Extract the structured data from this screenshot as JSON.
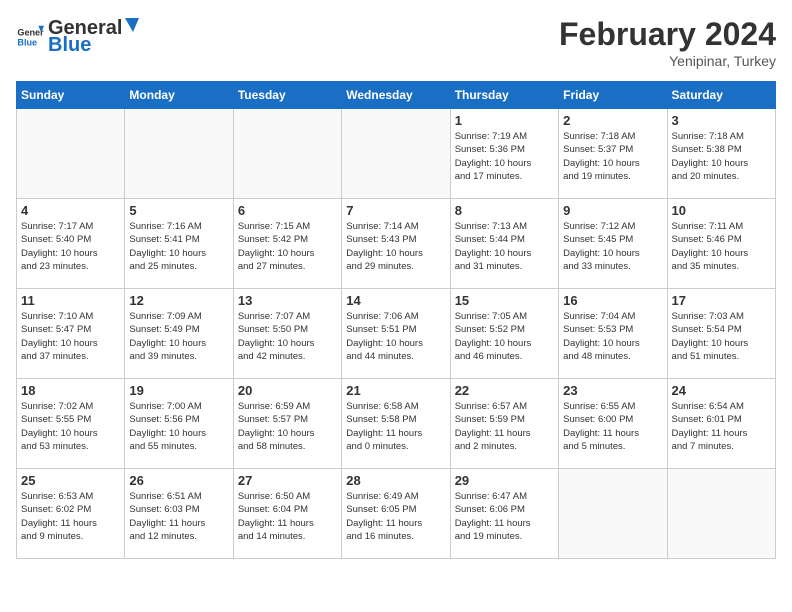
{
  "header": {
    "logo_general": "General",
    "logo_blue": "Blue",
    "title": "February 2024",
    "subtitle": "Yenipinar, Turkey"
  },
  "columns": [
    "Sunday",
    "Monday",
    "Tuesday",
    "Wednesday",
    "Thursday",
    "Friday",
    "Saturday"
  ],
  "weeks": [
    {
      "days": [
        {
          "num": "",
          "info": ""
        },
        {
          "num": "",
          "info": ""
        },
        {
          "num": "",
          "info": ""
        },
        {
          "num": "",
          "info": ""
        },
        {
          "num": "1",
          "info": "Sunrise: 7:19 AM\nSunset: 5:36 PM\nDaylight: 10 hours\nand 17 minutes."
        },
        {
          "num": "2",
          "info": "Sunrise: 7:18 AM\nSunset: 5:37 PM\nDaylight: 10 hours\nand 19 minutes."
        },
        {
          "num": "3",
          "info": "Sunrise: 7:18 AM\nSunset: 5:38 PM\nDaylight: 10 hours\nand 20 minutes."
        }
      ]
    },
    {
      "days": [
        {
          "num": "4",
          "info": "Sunrise: 7:17 AM\nSunset: 5:40 PM\nDaylight: 10 hours\nand 23 minutes."
        },
        {
          "num": "5",
          "info": "Sunrise: 7:16 AM\nSunset: 5:41 PM\nDaylight: 10 hours\nand 25 minutes."
        },
        {
          "num": "6",
          "info": "Sunrise: 7:15 AM\nSunset: 5:42 PM\nDaylight: 10 hours\nand 27 minutes."
        },
        {
          "num": "7",
          "info": "Sunrise: 7:14 AM\nSunset: 5:43 PM\nDaylight: 10 hours\nand 29 minutes."
        },
        {
          "num": "8",
          "info": "Sunrise: 7:13 AM\nSunset: 5:44 PM\nDaylight: 10 hours\nand 31 minutes."
        },
        {
          "num": "9",
          "info": "Sunrise: 7:12 AM\nSunset: 5:45 PM\nDaylight: 10 hours\nand 33 minutes."
        },
        {
          "num": "10",
          "info": "Sunrise: 7:11 AM\nSunset: 5:46 PM\nDaylight: 10 hours\nand 35 minutes."
        }
      ]
    },
    {
      "days": [
        {
          "num": "11",
          "info": "Sunrise: 7:10 AM\nSunset: 5:47 PM\nDaylight: 10 hours\nand 37 minutes."
        },
        {
          "num": "12",
          "info": "Sunrise: 7:09 AM\nSunset: 5:49 PM\nDaylight: 10 hours\nand 39 minutes."
        },
        {
          "num": "13",
          "info": "Sunrise: 7:07 AM\nSunset: 5:50 PM\nDaylight: 10 hours\nand 42 minutes."
        },
        {
          "num": "14",
          "info": "Sunrise: 7:06 AM\nSunset: 5:51 PM\nDaylight: 10 hours\nand 44 minutes."
        },
        {
          "num": "15",
          "info": "Sunrise: 7:05 AM\nSunset: 5:52 PM\nDaylight: 10 hours\nand 46 minutes."
        },
        {
          "num": "16",
          "info": "Sunrise: 7:04 AM\nSunset: 5:53 PM\nDaylight: 10 hours\nand 48 minutes."
        },
        {
          "num": "17",
          "info": "Sunrise: 7:03 AM\nSunset: 5:54 PM\nDaylight: 10 hours\nand 51 minutes."
        }
      ]
    },
    {
      "days": [
        {
          "num": "18",
          "info": "Sunrise: 7:02 AM\nSunset: 5:55 PM\nDaylight: 10 hours\nand 53 minutes."
        },
        {
          "num": "19",
          "info": "Sunrise: 7:00 AM\nSunset: 5:56 PM\nDaylight: 10 hours\nand 55 minutes."
        },
        {
          "num": "20",
          "info": "Sunrise: 6:59 AM\nSunset: 5:57 PM\nDaylight: 10 hours\nand 58 minutes."
        },
        {
          "num": "21",
          "info": "Sunrise: 6:58 AM\nSunset: 5:58 PM\nDaylight: 11 hours\nand 0 minutes."
        },
        {
          "num": "22",
          "info": "Sunrise: 6:57 AM\nSunset: 5:59 PM\nDaylight: 11 hours\nand 2 minutes."
        },
        {
          "num": "23",
          "info": "Sunrise: 6:55 AM\nSunset: 6:00 PM\nDaylight: 11 hours\nand 5 minutes."
        },
        {
          "num": "24",
          "info": "Sunrise: 6:54 AM\nSunset: 6:01 PM\nDaylight: 11 hours\nand 7 minutes."
        }
      ]
    },
    {
      "days": [
        {
          "num": "25",
          "info": "Sunrise: 6:53 AM\nSunset: 6:02 PM\nDaylight: 11 hours\nand 9 minutes."
        },
        {
          "num": "26",
          "info": "Sunrise: 6:51 AM\nSunset: 6:03 PM\nDaylight: 11 hours\nand 12 minutes."
        },
        {
          "num": "27",
          "info": "Sunrise: 6:50 AM\nSunset: 6:04 PM\nDaylight: 11 hours\nand 14 minutes."
        },
        {
          "num": "28",
          "info": "Sunrise: 6:49 AM\nSunset: 6:05 PM\nDaylight: 11 hours\nand 16 minutes."
        },
        {
          "num": "29",
          "info": "Sunrise: 6:47 AM\nSunset: 6:06 PM\nDaylight: 11 hours\nand 19 minutes."
        },
        {
          "num": "",
          "info": ""
        },
        {
          "num": "",
          "info": ""
        }
      ]
    }
  ]
}
